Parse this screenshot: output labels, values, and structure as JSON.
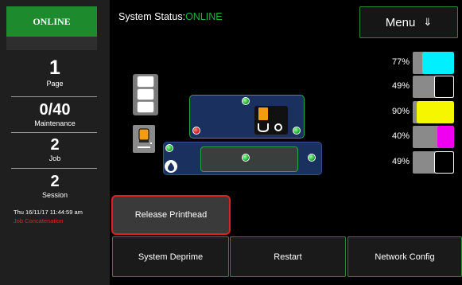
{
  "sidebar": {
    "online_label": "ONLINE",
    "counters": [
      {
        "value": "1",
        "label": "Page"
      },
      {
        "value": "0/40",
        "label": "Maintenance"
      },
      {
        "value": "2",
        "label": "Job"
      },
      {
        "value": "2",
        "label": "Session"
      }
    ],
    "timestamp": "Thu 16/11/17 11:44:59 am",
    "job_message": "Job Concatenation"
  },
  "header": {
    "status_prefix": "System Status:",
    "status_value": "ONLINE",
    "status_value_color": "#1cb43a",
    "menu_label": "Menu",
    "menu_icon": "⇓"
  },
  "ink_levels": [
    {
      "percent": "77%",
      "level": 0.77,
      "color": "#00f0ff",
      "fill_bg": "#8a8a8a"
    },
    {
      "percent": "49%",
      "level": 0.49,
      "color": "#000000",
      "fill_bg": "#8a8a8a"
    },
    {
      "percent": "90%",
      "level": 0.9,
      "color": "#f6f600",
      "fill_bg": "#8a8a8a"
    },
    {
      "percent": "40%",
      "level": 0.4,
      "color": "#f000f0",
      "fill_bg": "#8a8a8a"
    },
    {
      "percent": "49%",
      "level": 0.49,
      "color": "#000000",
      "fill_bg": "#8a8a8a"
    }
  ],
  "buttons": {
    "release_printhead": "Release Printhead",
    "system_deprime": "System Deprime",
    "restart": "Restart",
    "network_config": "Network Config"
  },
  "colors": {
    "online_green": "#1c8a2d",
    "button_border": "#2a8a3a",
    "panel_blue": "#1a3160",
    "alert_red": "#e02020"
  }
}
